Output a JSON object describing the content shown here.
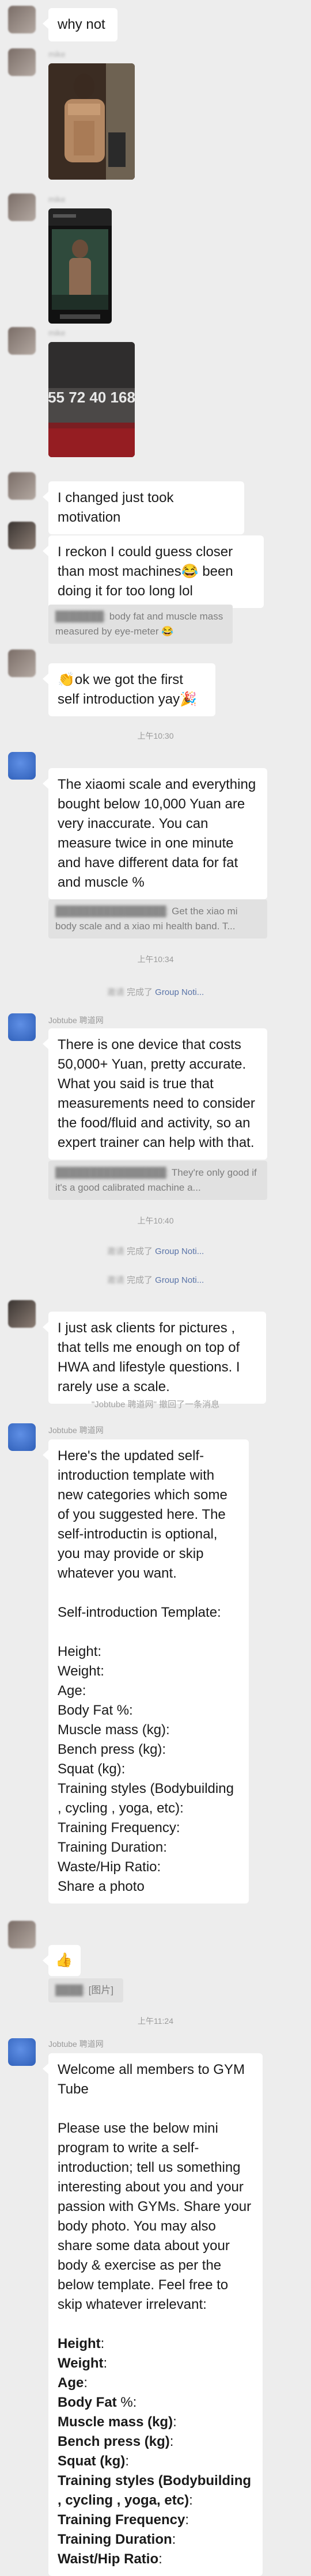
{
  "m1": {
    "text": "why not"
  },
  "m2": {
    "sender": "mike"
  },
  "m3": {
    "sender": "mike"
  },
  "m4": {
    "sender": "mike",
    "plate_text": "55 72 40 168"
  },
  "m5": {
    "text": "I changed just took motivation"
  },
  "m6": {
    "text": "I reckon I could guess closer than most machines😂 been doing it for too long lol",
    "quote": "body fat and muscle mass measured by eye-meter 😂"
  },
  "m7": {
    "text": "👏ok we got the first self introduction yay🎉"
  },
  "t1": "上午10:30",
  "m8": {
    "text": "The xiaomi scale and everything bought below 10,000 Yuan are very inaccurate. You can measure twice in one minute and have different data for fat and muscle %",
    "quote": "Get the xiao mi body scale and a xiao mi health band. T..."
  },
  "t2": "上午10:34",
  "s1": {
    "prefix": "邀请",
    "verb": "完成了 ",
    "link": "Group Noti..."
  },
  "m9": {
    "sender": "Jobtube 聘道网",
    "text": "There is one device that costs 50,000+ Yuan, pretty accurate. What you said is true that measurements need to consider the food/fluid and activity, so an expert trainer can help with that.",
    "quote": "They're only good if it's a good calibrated machine a..."
  },
  "t3": "上午10:40",
  "s2": {
    "prefix": "邀请",
    "verb": "完成了 ",
    "link": "Group Noti..."
  },
  "s3": {
    "prefix": "邀请",
    "verb": "完成了 ",
    "link": "Group Noti..."
  },
  "m10": {
    "text": "I just ask clients for pictures , that tells me enough on top of HWA and lifestyle questions.  I rarely use a scale."
  },
  "s4": {
    "text": "\"Jobtube 聘道网\" 撤回了一条消息"
  },
  "m11": {
    "sender": "Jobtube 聘道网",
    "intro": "Here's the updated self-introduction template with new categories which some of you suggested here. The self-introductin is optional, you may provide or skip whatever you want.",
    "title": "Self-introduction Template:",
    "fields": [
      "Height:",
      "Weight:",
      "Age:",
      "Body Fat %:",
      "Muscle mass (kg):",
      "Bench press (kg):",
      "Squat (kg):",
      "Training styles (Bodybuilding , cycling , yoga, etc):",
      "Training Frequency:",
      "Training Duration:",
      "Waste/Hip Ratio:",
      "Share a photo"
    ]
  },
  "m12": {
    "text": "👍"
  },
  "q12": {
    "text": "[图片]"
  },
  "t4": "上午11:24",
  "m13": {
    "sender": "Jobtube 聘道网",
    "intro": "Welcome all members to GYM Tube\n\nPlease use the below mini program to write a self-introduction; tell us something interesting about you and your passion with GYMs. Share your body photo. You may also share some data about your body & exercise as per the below template. Feel free to skip whatever irrelevant:",
    "fields": [
      "Height",
      "Weight",
      "Age",
      "Body Fat",
      "Muscle mass (kg)",
      "Bench press (kg)",
      "Squat (kg)",
      "Training styles (Bodybuilding , cycling , yoga, etc)",
      "Training Frequency",
      "Training Duration",
      "Waist/Hip Ratio"
    ],
    "suffixes": [
      ":",
      ":",
      ":",
      " %:",
      ":",
      ":",
      ":",
      ":",
      ":",
      ":",
      ":"
    ]
  }
}
